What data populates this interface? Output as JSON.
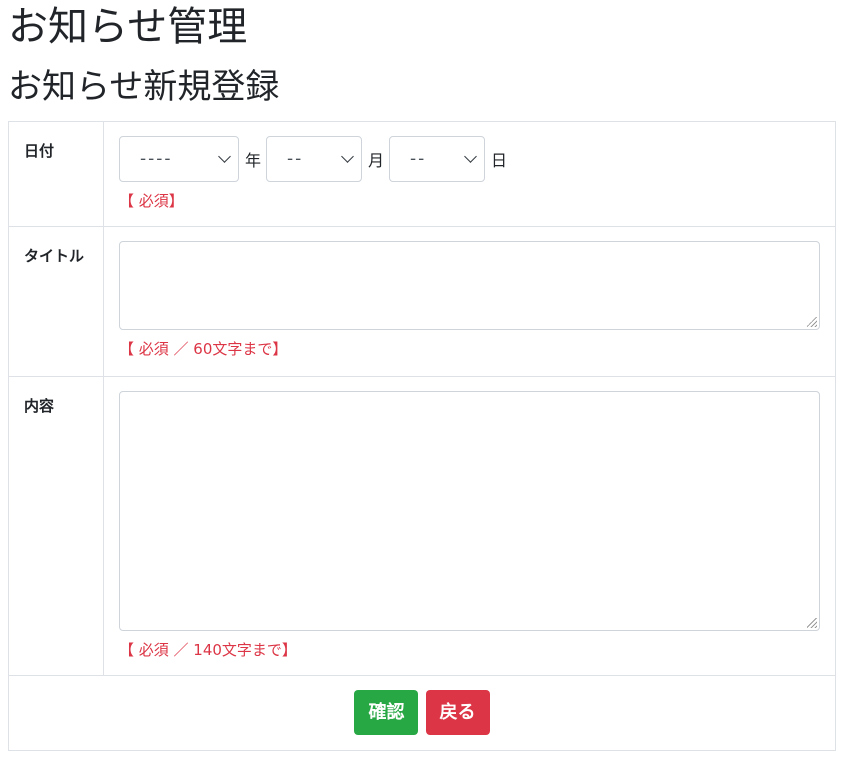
{
  "page": {
    "title": "お知らせ管理",
    "subtitle": "お知らせ新規登録"
  },
  "form": {
    "date": {
      "label": "日付",
      "year_value": "----",
      "year_unit": "年",
      "month_value": "--",
      "month_unit": "月",
      "day_value": "--",
      "day_unit": "日",
      "note": "【 必須】"
    },
    "title": {
      "label": "タイトル",
      "value": "",
      "note": "【 必須 ／ 60文字まで】"
    },
    "content": {
      "label": "内容",
      "value": "",
      "note": "【 必須 ／ 140文字まで】"
    }
  },
  "actions": {
    "confirm_label": "確認",
    "back_label": "戻る"
  },
  "colors": {
    "confirm": "#28a745",
    "back": "#dc3545",
    "required_note": "#dc3545"
  }
}
